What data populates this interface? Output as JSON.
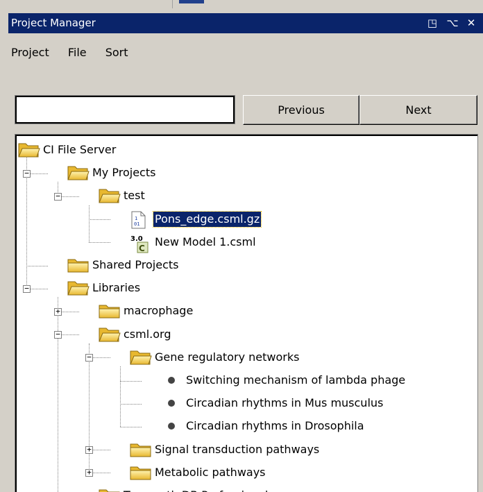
{
  "window": {
    "title": "Project Manager",
    "restore_glyph": "◳",
    "pin_glyph": "⌥",
    "close_glyph": "✕"
  },
  "menu": {
    "items": [
      "Project",
      "File",
      "Sort"
    ]
  },
  "search": {
    "value": "",
    "previous_label": "Previous",
    "next_label": "Next"
  },
  "tree": {
    "nodes": [
      {
        "label": "CI File Server",
        "icon": "folder-open-icon",
        "depth": 0
      },
      {
        "label": "My Projects",
        "icon": "folder-open-icon",
        "depth": 1,
        "expanded": true
      },
      {
        "label": "test",
        "icon": "folder-open-icon",
        "depth": 2,
        "expanded": true
      },
      {
        "label": "Pons_edge.csml.gz",
        "icon": "binary-file-icon",
        "depth": 3,
        "selected": true
      },
      {
        "label": "New Model 1.csml",
        "icon": "csml-model-icon",
        "depth": 3
      },
      {
        "label": "Shared Projects",
        "icon": "folder-icon",
        "depth": 1
      },
      {
        "label": "Libraries",
        "icon": "folder-open-icon",
        "depth": 1,
        "expanded": true
      },
      {
        "label": "macrophage",
        "icon": "folder-icon",
        "depth": 2,
        "expanded": false
      },
      {
        "label": "csml.org",
        "icon": "folder-open-icon",
        "depth": 2,
        "expanded": true
      },
      {
        "label": "Gene regulatory networks",
        "icon": "folder-open-icon",
        "depth": 3,
        "expanded": true
      },
      {
        "label": "Switching mechanism of lambda phage",
        "icon": "bullet-icon",
        "depth": 4
      },
      {
        "label": "Circadian rhythms in Mus musculus",
        "icon": "bullet-icon",
        "depth": 4
      },
      {
        "label": "Circadian rhythms in Drosophila",
        "icon": "bullet-icon",
        "depth": 4
      },
      {
        "label": "Signal transduction pathways",
        "icon": "folder-icon",
        "depth": 3,
        "expanded": false
      },
      {
        "label": "Metabolic pathways",
        "icon": "folder-icon",
        "depth": 3,
        "expanded": false
      },
      {
        "label": "Transpath DB Professional",
        "icon": "folder-icon",
        "depth": 2,
        "expanded": false
      }
    ],
    "csml_version_badge": "3.0",
    "csml_letter": "C",
    "binary_glyph_top": "1",
    "binary_glyph_bottom": "01"
  },
  "colors": {
    "titlebar": "#0a246a",
    "folder": "#f7d96b",
    "selection": "#0a246a"
  }
}
